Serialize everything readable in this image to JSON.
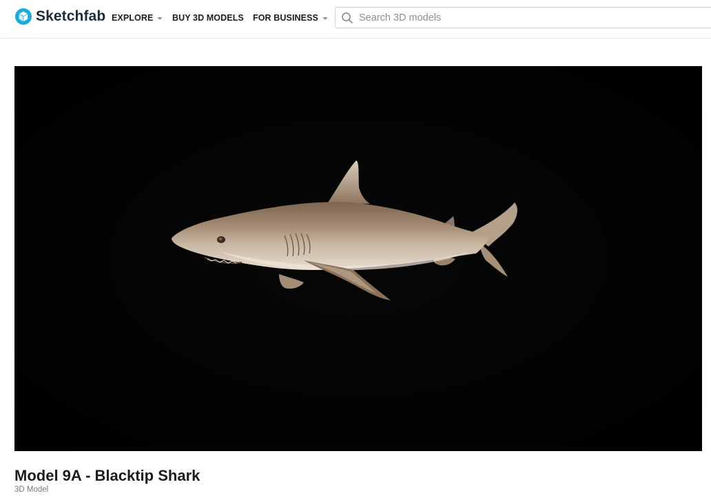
{
  "header": {
    "logo_text": "Sketchfab",
    "brand_color": "#1caad9",
    "nav": [
      {
        "label": "EXPLORE",
        "has_dropdown": true
      },
      {
        "label": "BUY 3D MODELS",
        "has_dropdown": false
      },
      {
        "label": "FOR BUSINESS",
        "has_dropdown": true
      }
    ],
    "search": {
      "placeholder": "Search 3D models",
      "value": "",
      "icon": "search-icon"
    }
  },
  "viewer": {
    "background": "#000000",
    "subject": "blacktip shark 3D model"
  },
  "model": {
    "title": "Model 9A - Blacktip Shark",
    "type_label": "3D Model"
  }
}
